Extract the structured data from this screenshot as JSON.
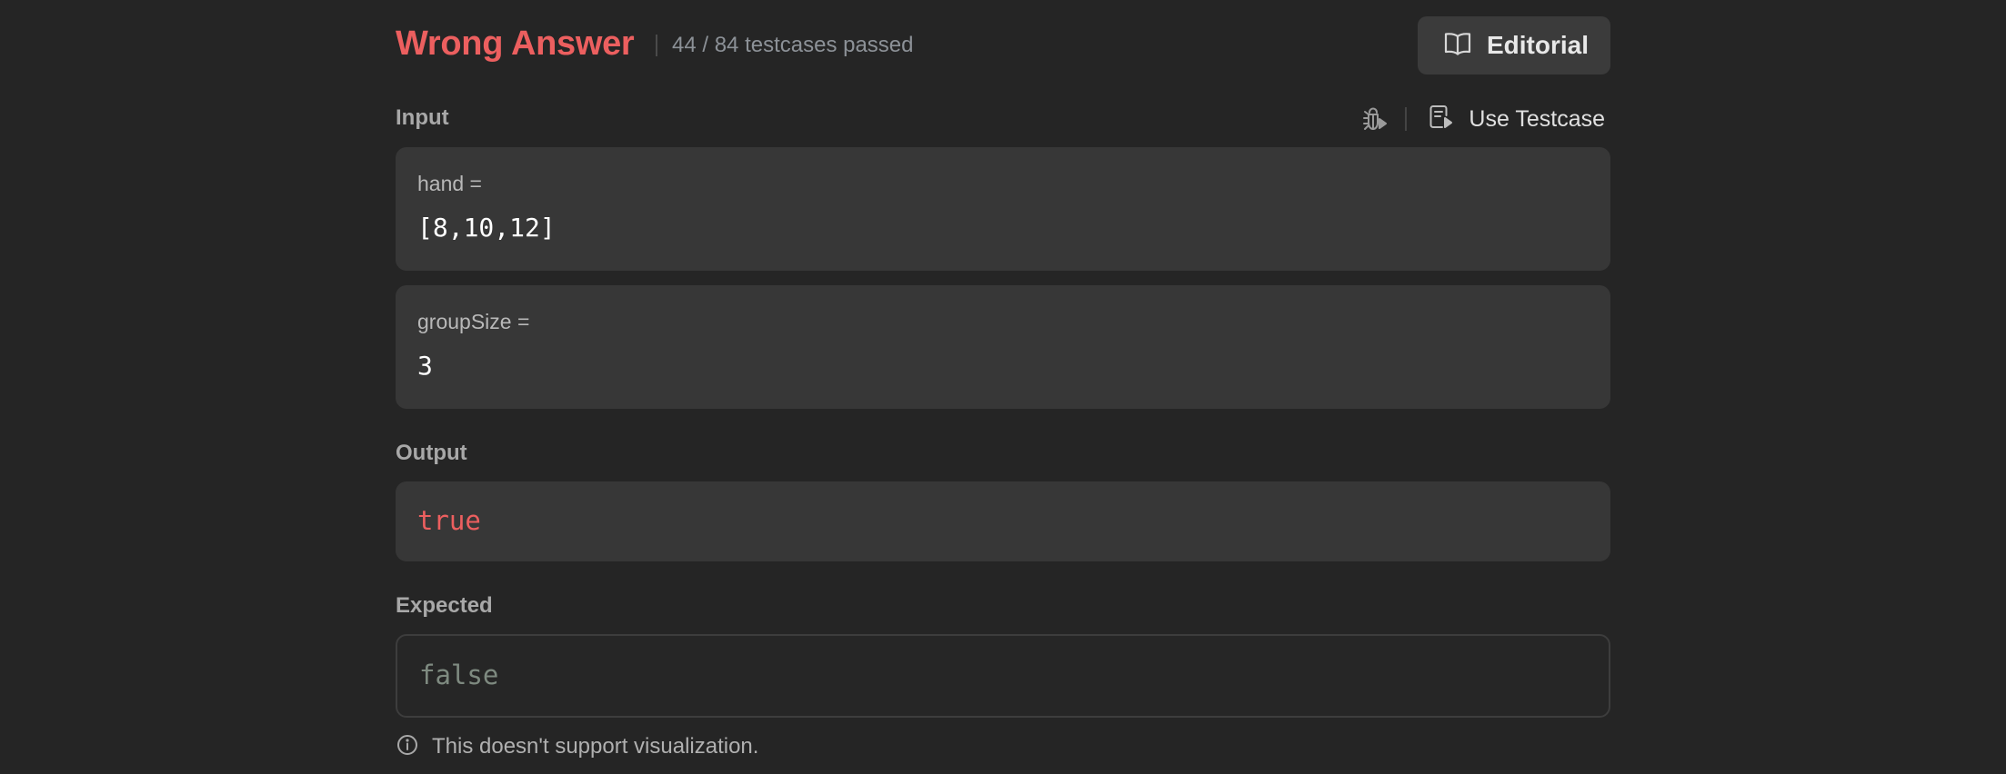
{
  "result": {
    "status": "Wrong Answer",
    "passed_text": "44 / 84 testcases passed",
    "status_color": "#EC5F5F"
  },
  "toolbar": {
    "editorial_label": "Editorial",
    "editorial_icon": "book-open-icon",
    "debug_icon": "debug-bug-icon",
    "use_testcase_label": "Use Testcase",
    "use_testcase_icon": "file-play-icon"
  },
  "input": {
    "label": "Input",
    "params": [
      {
        "name": "hand =",
        "value": "[8,10,12]"
      },
      {
        "name": "groupSize =",
        "value": "3"
      }
    ]
  },
  "output": {
    "label": "Output",
    "value": "true"
  },
  "expected": {
    "label": "Expected",
    "value": "false"
  },
  "note": {
    "icon": "info-circle-icon",
    "text": "This doesn't support visualization."
  }
}
